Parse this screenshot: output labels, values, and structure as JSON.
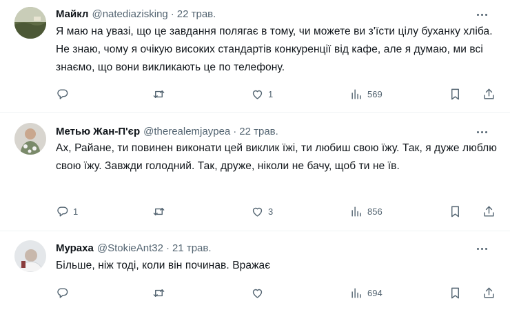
{
  "tweets": [
    {
      "name": "Майкл",
      "handle": "@natediazisking",
      "dot": "·",
      "time": "22 трав.",
      "text": "Я маю на увазі, що це завдання полягає в тому, чи можете ви з'їсти цілу буханку хліба. Не знаю, чому я очікую високих стандартів конкуренції від кафе, але я думаю, ми всі знаємо, що вони викликають це по телефону.",
      "replies": "",
      "retweets": "",
      "likes": "1",
      "views": "569"
    },
    {
      "name": "Метью Жан-П'єр",
      "handle": "@therealemjaypea",
      "dot": "·",
      "time": "22 трав.",
      "text": "Ах, Райане, ти повинен виконати цей виклик їжі, ти любиш свою їжу. Так, я дуже люблю свою їжу. Завжди голодний. Так, друже, ніколи не бачу, щоб ти не їв.",
      "replies": "1",
      "retweets": "",
      "likes": "3",
      "views": "856"
    },
    {
      "name": "Мураха",
      "handle": "@StokieAnt32",
      "dot": "·",
      "time": "21 трав.",
      "text": "Більше, ніж тоді, коли він починав. Вражає",
      "replies": "",
      "retweets": "",
      "likes": "",
      "views": "694"
    }
  ],
  "icons": {
    "reply": "reply-icon",
    "retweet": "retweet-icon",
    "like": "heart-icon",
    "views": "views-icon",
    "bookmark": "bookmark-icon",
    "share": "share-icon",
    "more": "more-icon"
  },
  "colors": {
    "text": "#0f1419",
    "secondary": "#536471",
    "divider": "#eff3f4"
  }
}
